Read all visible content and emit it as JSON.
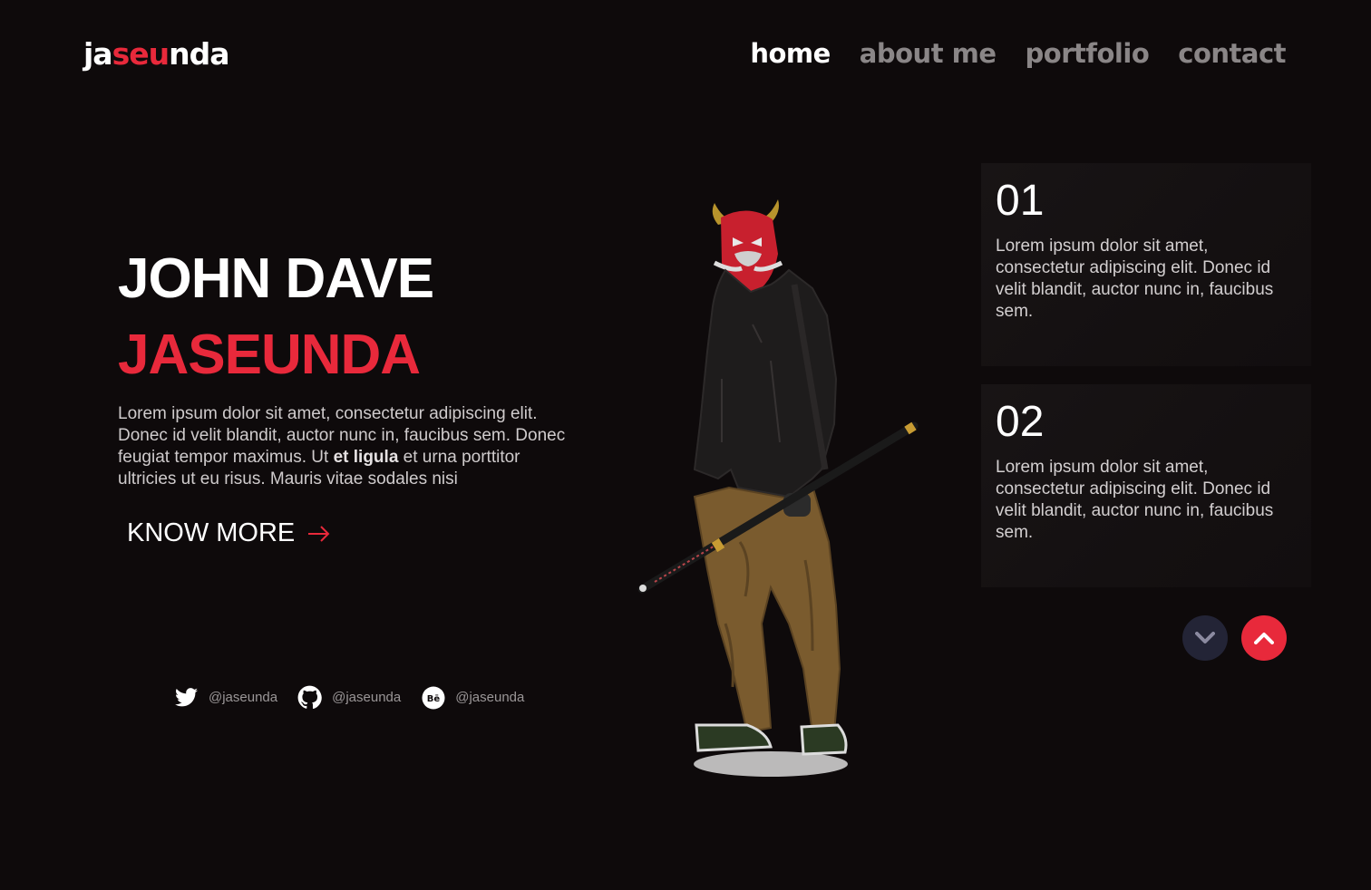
{
  "logo": {
    "part1": "ja",
    "part2": "seu",
    "part3": "nda"
  },
  "nav": {
    "items": [
      {
        "label": "home",
        "active": true
      },
      {
        "label": "about me",
        "active": false
      },
      {
        "label": "portfolio",
        "active": false
      },
      {
        "label": "contact",
        "active": false
      }
    ]
  },
  "hero": {
    "first_name": "JOHN DAVE",
    "last_name": "JASEUNDA",
    "description_part1": "Lorem ipsum dolor sit amet, consectetur adipiscing elit. Donec id velit blandit, auctor nunc in, faucibus sem. Donec feugiat tempor maximus. Ut ",
    "description_bold": "et ligula",
    "description_part2": " et urna porttitor ultricies ut eu risus. Mauris vitae sodales nisi",
    "cta_label": "KNOW MORE"
  },
  "socials": [
    {
      "icon": "twitter-icon",
      "handle": "@jaseunda"
    },
    {
      "icon": "github-icon",
      "handle": "@jaseunda"
    },
    {
      "icon": "behance-icon",
      "handle": "@jaseunda"
    }
  ],
  "cards": [
    {
      "number": "01",
      "text": "Lorem ipsum dolor sit amet, consectetur adipiscing elit. Donec id velit blandit, auctor nunc in, faucibus sem."
    },
    {
      "number": "02",
      "text": "Lorem ipsum dolor sit amet, consectetur adipiscing elit. Donec id velit blandit, auctor nunc in, faucibus sem."
    }
  ],
  "colors": {
    "background": "#0e0a0b",
    "accent": "#e8293b",
    "nav_inactive": "#8a8687",
    "down_button": "#232436"
  }
}
